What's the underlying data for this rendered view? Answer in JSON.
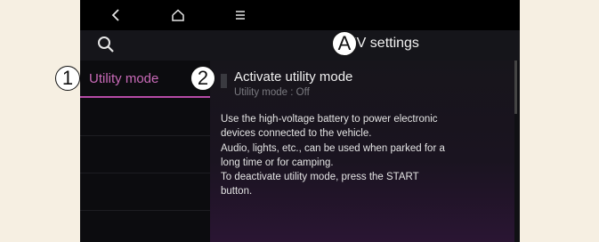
{
  "topbar": {
    "icons": [
      "back-icon",
      "home-icon",
      "menu-icon"
    ]
  },
  "header": {
    "title": "EV settings",
    "search_icon": "search-icon"
  },
  "callouts": {
    "a": "A",
    "one": "1",
    "two": "2"
  },
  "sidebar": {
    "items": [
      {
        "label": "Utility mode",
        "selected": true
      }
    ]
  },
  "main": {
    "option_title": "Activate utility mode",
    "option_status": "Utility mode : Off",
    "description_lines": [
      "Use the high-voltage battery to power electronic",
      "devices connected to the vehicle.",
      "Audio, lights, etc., can be used when parked for a",
      "long time or for camping.",
      "To deactivate utility mode, press the START",
      "button."
    ]
  },
  "colors": {
    "accent": "#c96ab8",
    "background": "#101014",
    "page": "#f6efe2"
  }
}
